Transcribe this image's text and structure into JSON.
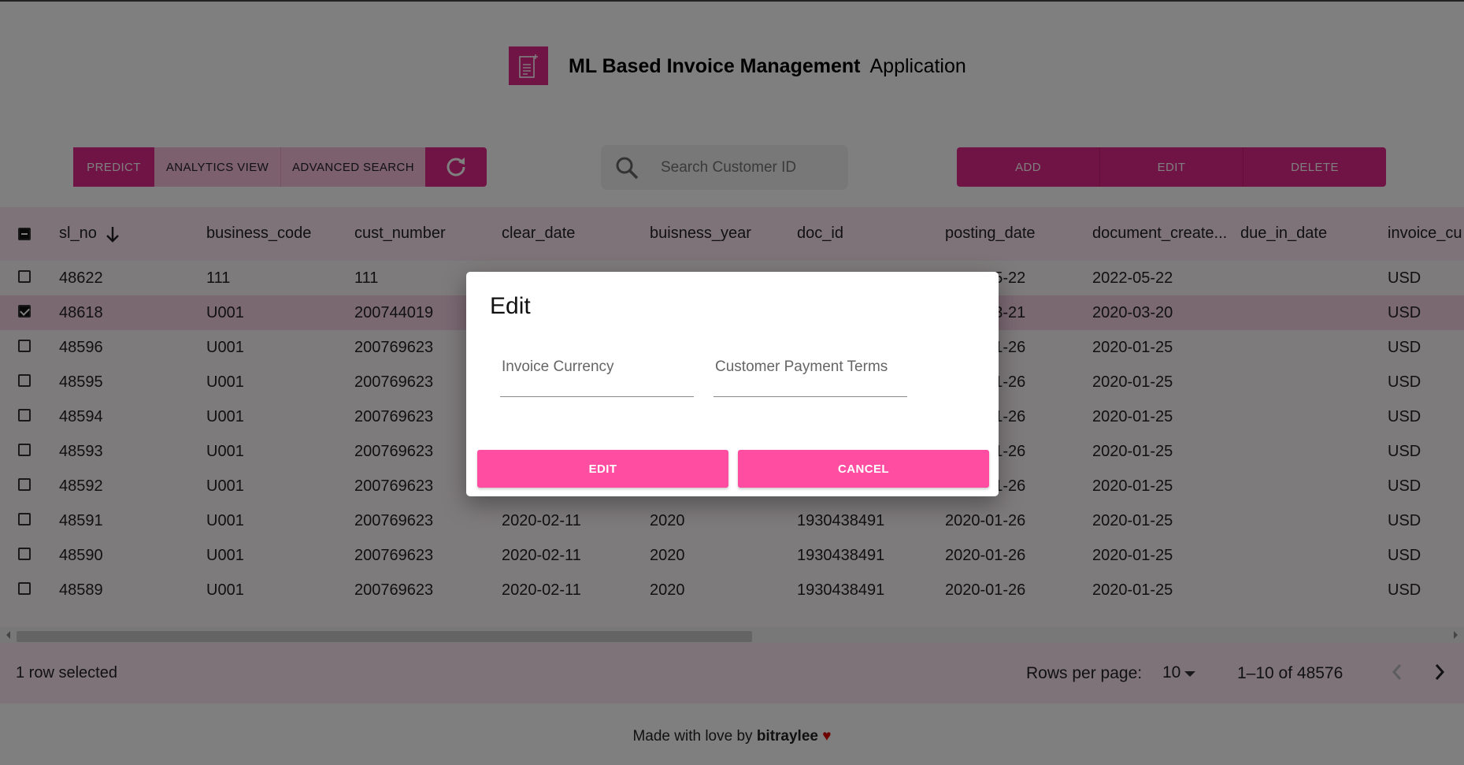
{
  "header": {
    "title_bold": "ML Based Invoice Management",
    "title_light": "Application",
    "logo_icon": "invoice-document-icon"
  },
  "toolbar": {
    "predict": "PREDICT",
    "analytics": "ANALYTICS VIEW",
    "advanced_search": "ADVANCED SEARCH",
    "refresh_icon": "refresh-icon",
    "search_placeholder": "Search Customer ID",
    "add": "ADD",
    "edit": "EDIT",
    "delete": "DELETE"
  },
  "grid": {
    "columns": [
      "sl_no",
      "business_code",
      "cust_number",
      "clear_date",
      "buisness_year",
      "doc_id",
      "posting_date",
      "document_create...",
      "due_in_date",
      "invoice_cu"
    ],
    "rows": [
      {
        "sl_no": "48622",
        "business_code": "111",
        "cust_number": "111",
        "clear_date": "",
        "buisness_year": "",
        "doc_id": "",
        "posting_date": "2022-05-22",
        "document_create": "2022-05-22",
        "due_in_date": "",
        "invoice_currency": "USD",
        "checked": false
      },
      {
        "sl_no": "48618",
        "business_code": "U001",
        "cust_number": "200744019",
        "clear_date": "",
        "buisness_year": "",
        "doc_id": "",
        "posting_date": "2020-03-21",
        "document_create": "2020-03-20",
        "due_in_date": "",
        "invoice_currency": "USD",
        "checked": true
      },
      {
        "sl_no": "48596",
        "business_code": "U001",
        "cust_number": "200769623",
        "clear_date": "",
        "buisness_year": "",
        "doc_id": "",
        "posting_date": "2020-01-26",
        "document_create": "2020-01-25",
        "due_in_date": "",
        "invoice_currency": "USD",
        "checked": false
      },
      {
        "sl_no": "48595",
        "business_code": "U001",
        "cust_number": "200769623",
        "clear_date": "",
        "buisness_year": "",
        "doc_id": "",
        "posting_date": "2020-01-26",
        "document_create": "2020-01-25",
        "due_in_date": "",
        "invoice_currency": "USD",
        "checked": false
      },
      {
        "sl_no": "48594",
        "business_code": "U001",
        "cust_number": "200769623",
        "clear_date": "",
        "buisness_year": "",
        "doc_id": "",
        "posting_date": "2020-01-26",
        "document_create": "2020-01-25",
        "due_in_date": "",
        "invoice_currency": "USD",
        "checked": false
      },
      {
        "sl_no": "48593",
        "business_code": "U001",
        "cust_number": "200769623",
        "clear_date": "",
        "buisness_year": "",
        "doc_id": "",
        "posting_date": "2020-01-26",
        "document_create": "2020-01-25",
        "due_in_date": "",
        "invoice_currency": "USD",
        "checked": false
      },
      {
        "sl_no": "48592",
        "business_code": "U001",
        "cust_number": "200769623",
        "clear_date": "",
        "buisness_year": "",
        "doc_id": "",
        "posting_date": "2020-01-26",
        "document_create": "2020-01-25",
        "due_in_date": "",
        "invoice_currency": "USD",
        "checked": false
      },
      {
        "sl_no": "48591",
        "business_code": "U001",
        "cust_number": "200769623",
        "clear_date": "2020-02-11",
        "buisness_year": "2020",
        "doc_id": "1930438491",
        "posting_date": "2020-01-26",
        "document_create": "2020-01-25",
        "due_in_date": "",
        "invoice_currency": "USD",
        "checked": false
      },
      {
        "sl_no": "48590",
        "business_code": "U001",
        "cust_number": "200769623",
        "clear_date": "2020-02-11",
        "buisness_year": "2020",
        "doc_id": "1930438491",
        "posting_date": "2020-01-26",
        "document_create": "2020-01-25",
        "due_in_date": "",
        "invoice_currency": "USD",
        "checked": false
      },
      {
        "sl_no": "48589",
        "business_code": "U001",
        "cust_number": "200769623",
        "clear_date": "2020-02-11",
        "buisness_year": "2020",
        "doc_id": "1930438491",
        "posting_date": "2020-01-26",
        "document_create": "2020-01-25",
        "due_in_date": "",
        "invoice_currency": "USD",
        "checked": false
      }
    ]
  },
  "footer": {
    "selected_text": "1 row selected",
    "rows_per_page_label": "Rows per page:",
    "rows_per_page_value": "10",
    "range": "1–10 of 48576"
  },
  "credit": {
    "prefix": "Made with love by",
    "author": "bitraylee",
    "heart": "♥"
  },
  "dialog": {
    "title": "Edit",
    "field1_placeholder": "Invoice Currency",
    "field2_placeholder": "Customer Payment Terms",
    "edit_button": "EDIT",
    "cancel_button": "CANCEL"
  },
  "colors": {
    "brand": "#e0288a",
    "brand_light": "#f8c0dd",
    "dialog_button": "#ff4ea2"
  }
}
